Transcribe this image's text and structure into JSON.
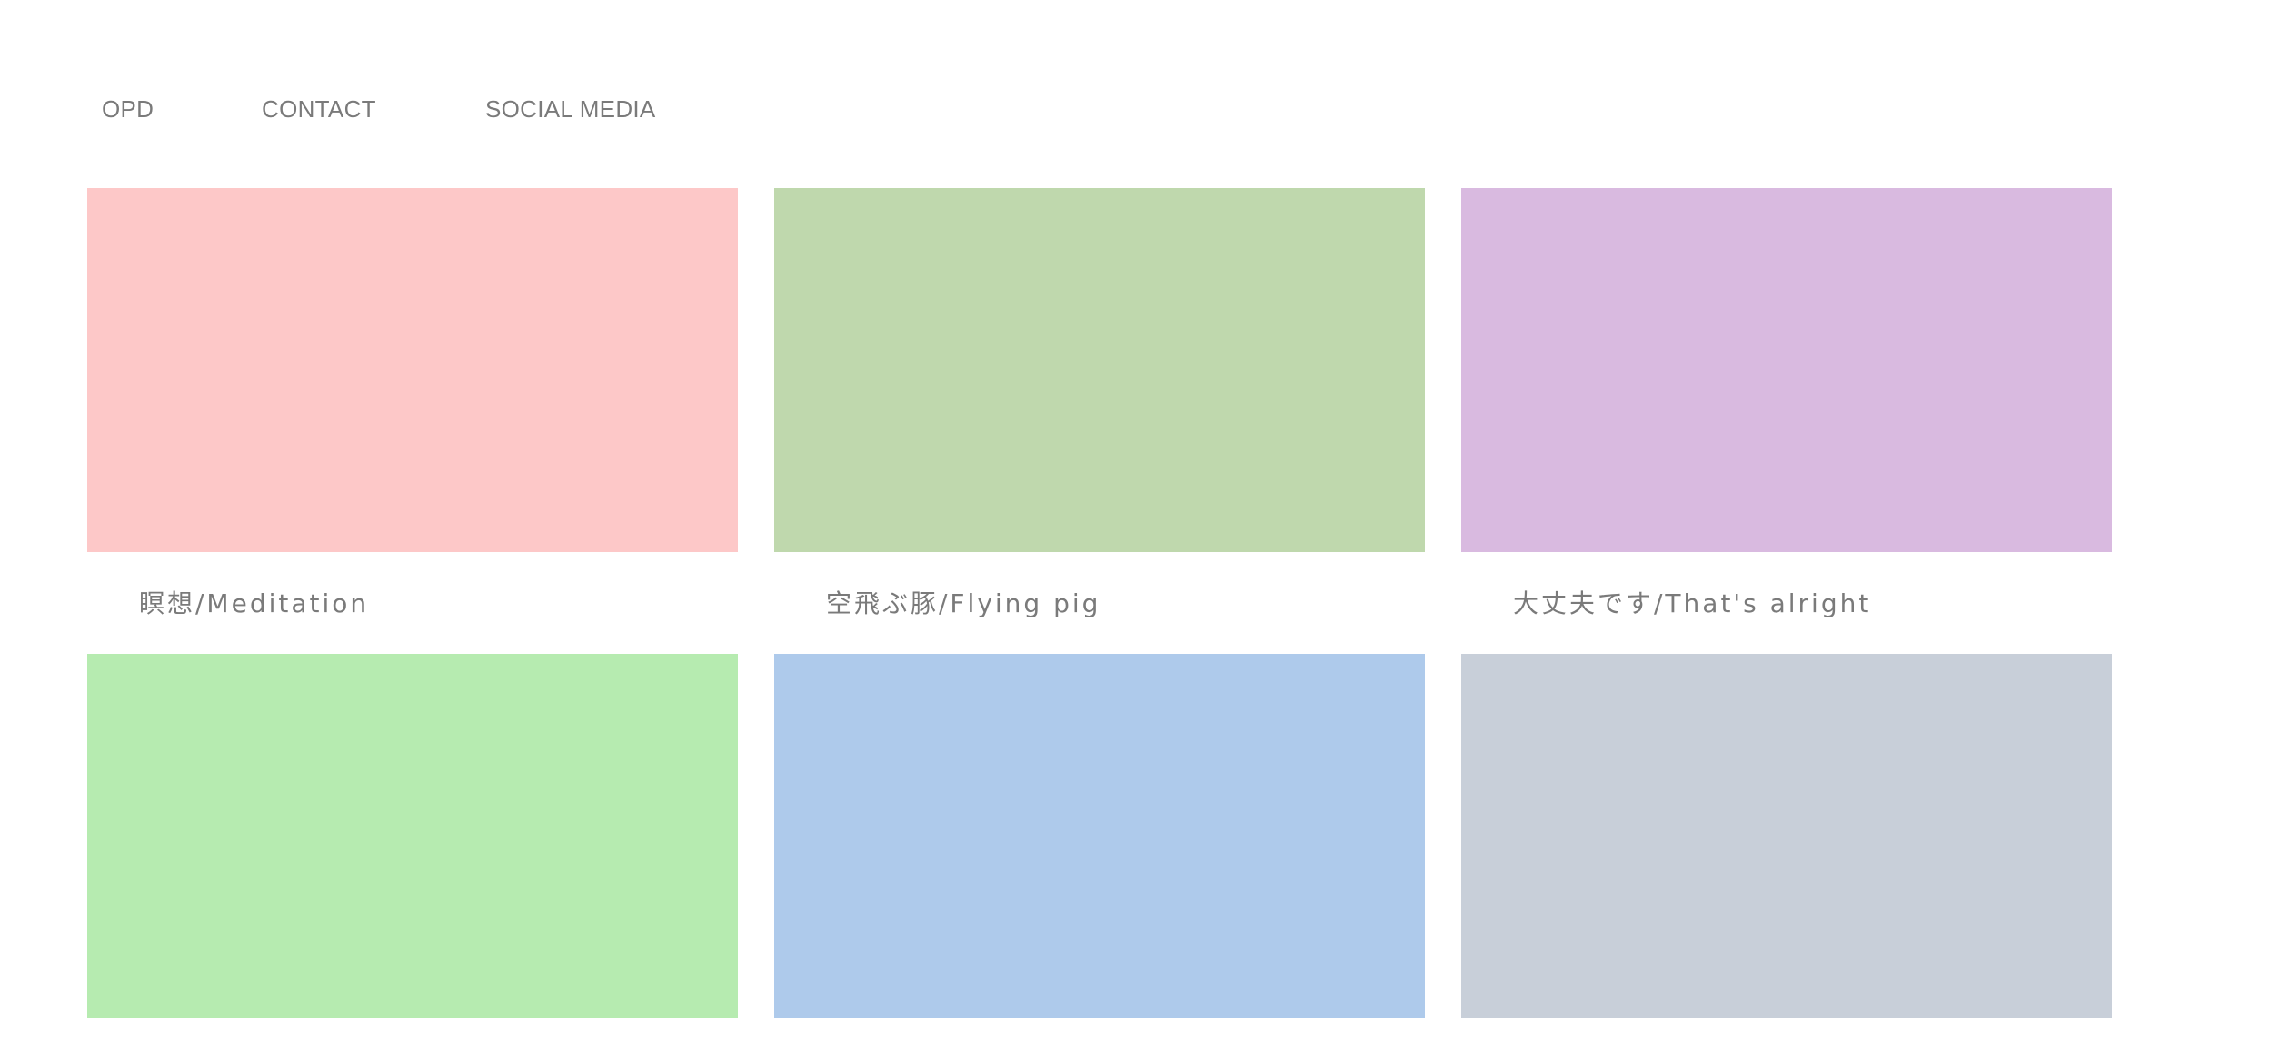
{
  "nav": {
    "items": [
      {
        "label": "OPD"
      },
      {
        "label": "CONTACT"
      },
      {
        "label": "SOCIAL MEDIA"
      }
    ]
  },
  "gallery": {
    "items": [
      {
        "title": "瞑想/Meditation",
        "color": "#fdc8c8"
      },
      {
        "title": "空飛ぶ豚/Flying pig",
        "color": "#bfd8ad"
      },
      {
        "title": "大丈夫です/That's alright",
        "color": "#d9bae0"
      },
      {
        "title": "",
        "color": "#b6ebb0"
      },
      {
        "title": "",
        "color": "#aecaeb"
      },
      {
        "title": "",
        "color": "#c8cfd9"
      }
    ]
  }
}
